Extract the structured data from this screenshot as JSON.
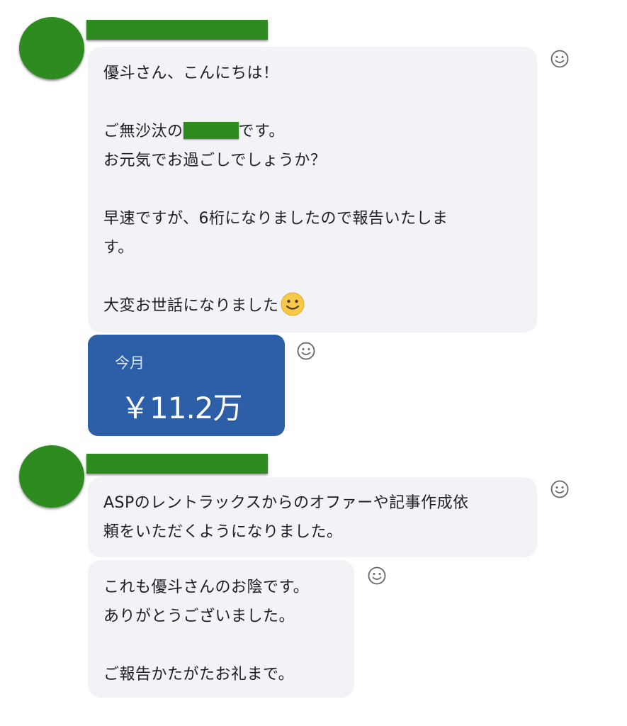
{
  "message_group_1": {
    "bubble": {
      "lines": [
        "優斗さん、こんにちは！",
        "",
        "ご無沙汰の",
        "です。",
        "お元気でお過ごしでしょうか？",
        "",
        "早速ですが、6桁になりましたので報告いたしま",
        "す。",
        "",
        "大変お世話になりました"
      ],
      "emoji": "smiling-face-emoji"
    },
    "revenue_card": {
      "label": "今月",
      "value": "￥11.2万"
    }
  },
  "message_group_2": {
    "bubble_1": {
      "lines": [
        "ASPのレントラックスからのオファーや記事作成依",
        "頼をいただくようになりました。"
      ]
    },
    "bubble_2": {
      "lines": [
        "これも優斗さんのお陰です。",
        "ありがとうございました。",
        "",
        "ご報告かたがたお礼まで。"
      ]
    }
  },
  "icons": {
    "reaction": "add-reaction-icon",
    "avatar": "redacted-avatar",
    "name": "redacted-name"
  },
  "colors": {
    "redaction_green": "#2e8b1f",
    "bubble_bg": "#f1f3f6",
    "card_blue": "#2c5fa8",
    "text": "#1c1e21"
  }
}
